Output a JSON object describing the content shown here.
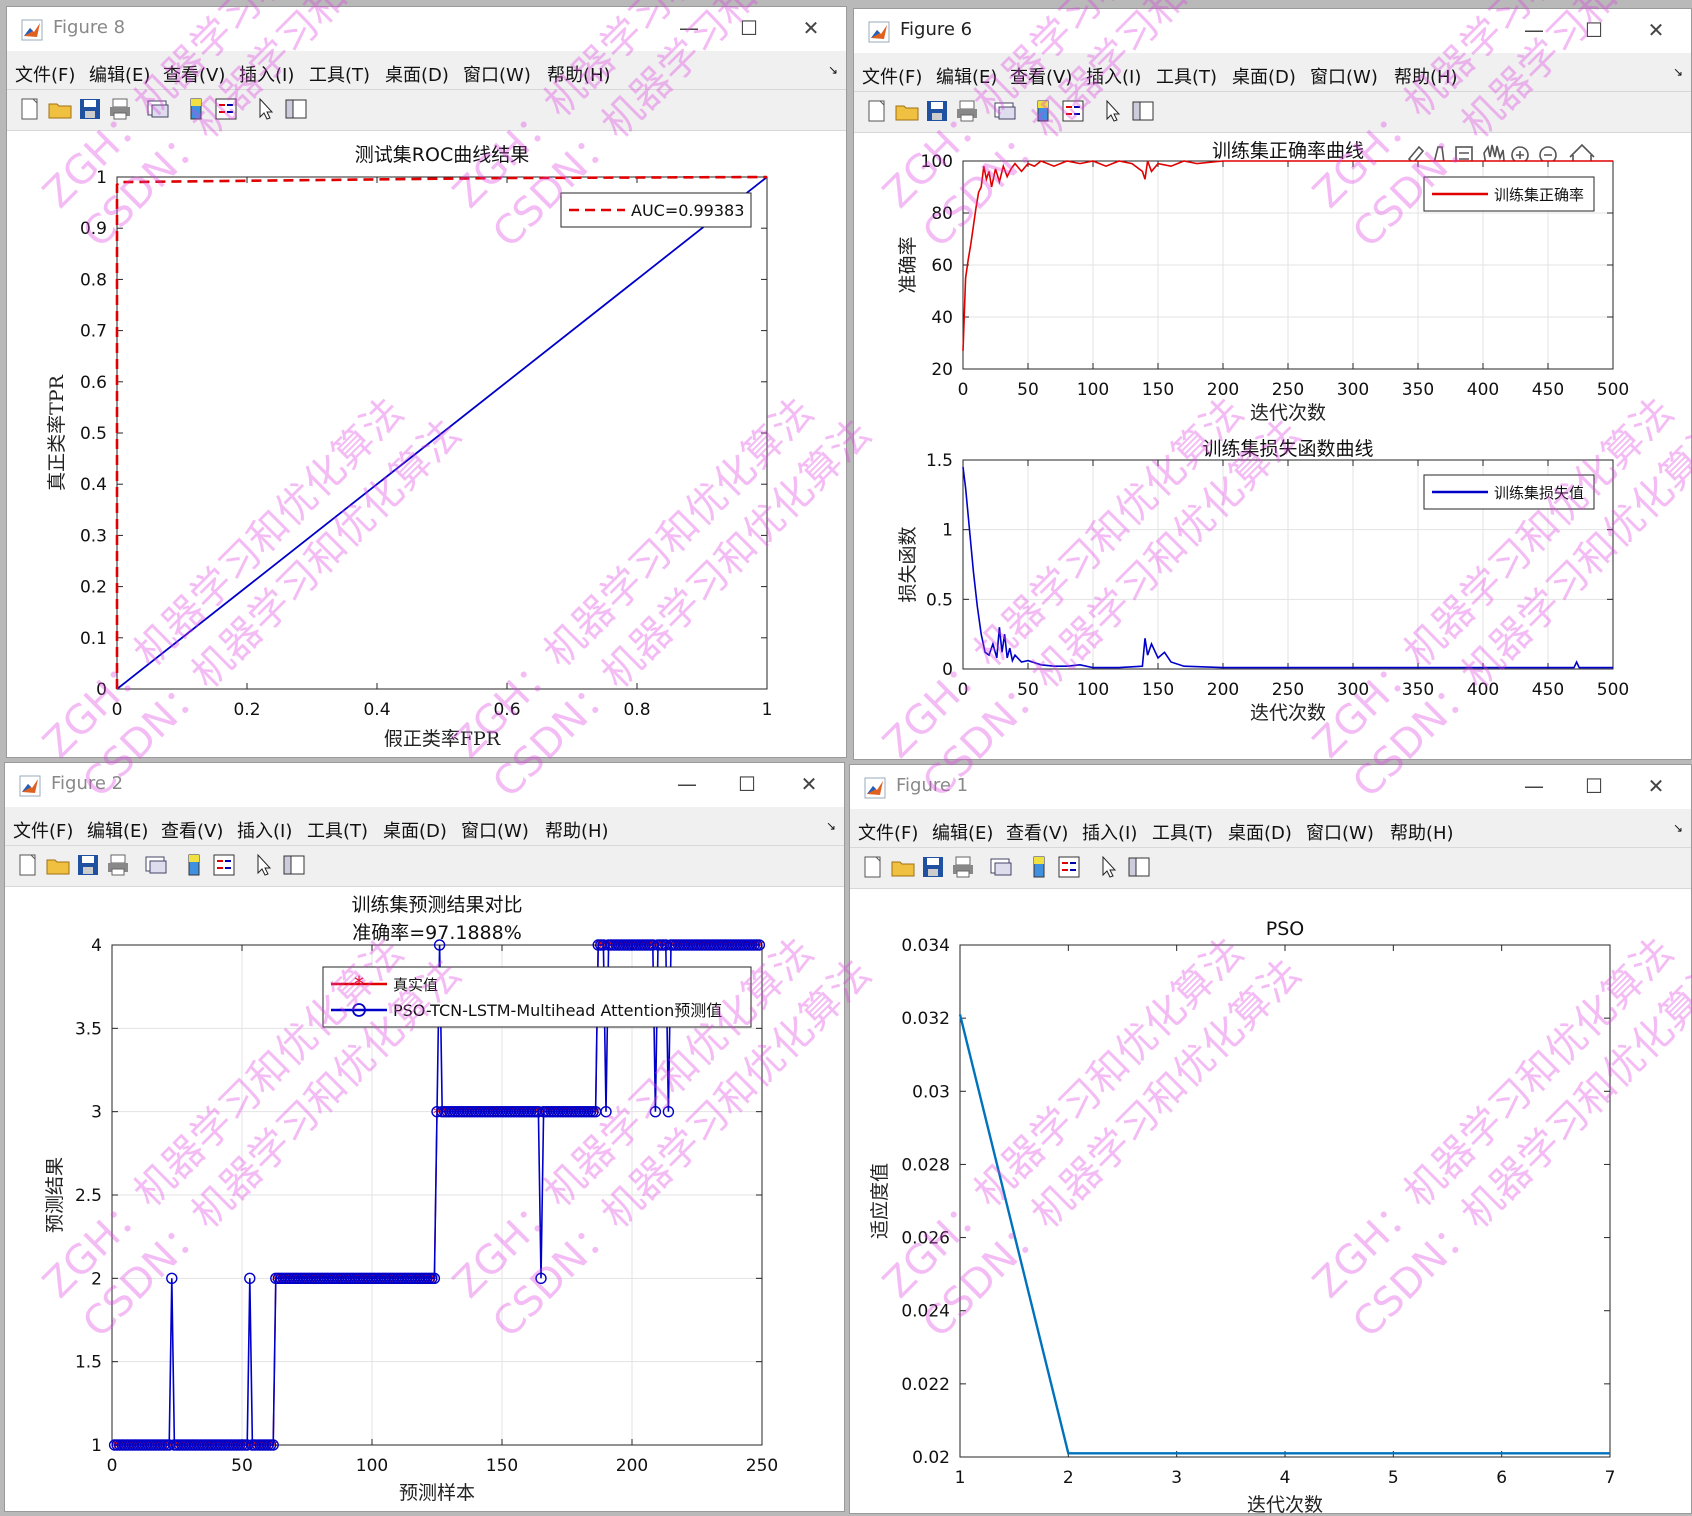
{
  "menu": [
    "文件(F)",
    "编辑(E)",
    "查看(V)",
    "插入(I)",
    "工具(T)",
    "桌面(D)",
    "窗口(W)",
    "帮助(H)"
  ],
  "windows": {
    "fig8": {
      "title": "Figure 8"
    },
    "fig6": {
      "title": "Figure 6"
    },
    "fig2": {
      "title": "Figure 2"
    },
    "fig1": {
      "title": "Figure 1"
    }
  },
  "watermark_lines": [
    "ZGH：机器学习和优化算法",
    "CSDN：机器学习和优化算法"
  ],
  "chart_data": [
    {
      "id": "roc",
      "type": "line",
      "title": "测试集ROC曲线结果",
      "xlabel": "假正类率FPR",
      "ylabel": "真正类率TPR",
      "xlim": [
        0,
        1
      ],
      "ylim": [
        0,
        1
      ],
      "xticks": [
        "0",
        "0.2",
        "0.4",
        "0.6",
        "0.8",
        "1"
      ],
      "yticks": [
        "0",
        "0.1",
        "0.2",
        "0.3",
        "0.4",
        "0.5",
        "0.6",
        "0.7",
        "0.8",
        "0.9",
        "1"
      ],
      "grid": false,
      "legend": "top-right",
      "series": [
        {
          "name": "AUC=0.99383",
          "color": "#e00000",
          "dash": true,
          "x": [
            0,
            0,
            0.003,
            0.3,
            0.6,
            1
          ],
          "y": [
            0,
            0.985,
            0.99,
            0.994,
            0.998,
            1
          ]
        },
        {
          "color": "#0000c8",
          "dash": false,
          "x": [
            0,
            1
          ],
          "y": [
            0,
            1
          ]
        }
      ]
    },
    {
      "id": "acc",
      "type": "line",
      "title": "训练集正确率曲线",
      "xlabel": "迭代次数",
      "ylabel": "准确率",
      "xlim": [
        0,
        500
      ],
      "ylim": [
        20,
        100
      ],
      "xticks": [
        "0",
        "50",
        "100",
        "150",
        "200",
        "250",
        "300",
        "350",
        "400",
        "450",
        "500"
      ],
      "yticks": [
        "20",
        "40",
        "60",
        "80",
        "100"
      ],
      "grid": true,
      "legend": "top-right",
      "series": [
        {
          "name": "训练集正确率",
          "color": "#e00000",
          "x": [
            0,
            2,
            4,
            6,
            8,
            10,
            12,
            14,
            16,
            18,
            20,
            22,
            25,
            28,
            31,
            34,
            37,
            40,
            45,
            50,
            55,
            60,
            70,
            80,
            90,
            100,
            110,
            120,
            130,
            138,
            140,
            142,
            145,
            150,
            160,
            170,
            180,
            200,
            250,
            300,
            350,
            400,
            450,
            500
          ],
          "y": [
            27,
            55,
            62,
            68,
            75,
            82,
            88,
            90,
            98,
            93,
            96,
            90,
            97,
            92,
            98,
            94,
            97,
            99,
            96,
            99,
            98,
            100,
            98,
            100,
            99,
            100,
            98,
            100,
            99,
            96,
            93,
            100,
            96,
            99,
            98,
            100,
            99,
            100,
            100,
            100,
            100,
            100,
            100,
            100
          ]
        }
      ]
    },
    {
      "id": "loss",
      "type": "line",
      "title": "训练集损失函数曲线",
      "xlabel": "迭代次数",
      "ylabel": "损失函数",
      "xlim": [
        0,
        500
      ],
      "ylim": [
        0,
        1.5
      ],
      "xticks": [
        "0",
        "50",
        "100",
        "150",
        "200",
        "250",
        "300",
        "350",
        "400",
        "450",
        "500"
      ],
      "yticks": [
        "0",
        "0.5",
        "1",
        "1.5"
      ],
      "grid": true,
      "legend": "top-right",
      "series": [
        {
          "name": "训练集损失值",
          "color": "#0000c8",
          "x": [
            0,
            2,
            5,
            8,
            11,
            14,
            17,
            20,
            23,
            26,
            28,
            30,
            32,
            34,
            36,
            38,
            40,
            45,
            50,
            60,
            70,
            80,
            90,
            100,
            120,
            138,
            140,
            142,
            145,
            150,
            155,
            160,
            170,
            200,
            250,
            300,
            350,
            400,
            470,
            472,
            474,
            500
          ],
          "y": [
            1.45,
            1.3,
            1.0,
            0.7,
            0.45,
            0.25,
            0.12,
            0.1,
            0.18,
            0.08,
            0.3,
            0.12,
            0.25,
            0.08,
            0.15,
            0.06,
            0.1,
            0.05,
            0.06,
            0.03,
            0.02,
            0.02,
            0.03,
            0.01,
            0.01,
            0.02,
            0.22,
            0.1,
            0.18,
            0.08,
            0.12,
            0.05,
            0.02,
            0.01,
            0.01,
            0.01,
            0.01,
            0.01,
            0.01,
            0.05,
            0.01,
            0.01
          ]
        }
      ]
    },
    {
      "id": "pred",
      "type": "line",
      "title": "训练集预测结果对比",
      "subtitle": "准确率=97.1888%",
      "xlabel": "预测样本",
      "ylabel": "预测结果",
      "xlim": [
        0,
        250
      ],
      "ylim": [
        1,
        4
      ],
      "xticks": [
        "0",
        "50",
        "100",
        "150",
        "200",
        "250"
      ],
      "yticks": [
        "1",
        "1.5",
        "2",
        "2.5",
        "3",
        "3.5",
        "4"
      ],
      "grid": true,
      "legend": "top-right",
      "segments_true": [
        {
          "from": 1,
          "to": 63,
          "class": 1
        },
        {
          "from": 63,
          "to": 125,
          "class": 2
        },
        {
          "from": 125,
          "to": 187,
          "class": 3
        },
        {
          "from": 187,
          "to": 249,
          "class": 4
        }
      ],
      "mismatches": [
        {
          "x": 23,
          "pred": 2
        },
        {
          "x": 53,
          "pred": 2
        },
        {
          "x": 126,
          "pred": 4
        },
        {
          "x": 165,
          "pred": 2
        },
        {
          "x": 190,
          "pred": 3
        },
        {
          "x": 209,
          "pred": 3
        },
        {
          "x": 214,
          "pred": 3
        }
      ],
      "series": [
        {
          "name": "真实值",
          "color": "#e00000",
          "marker": "*"
        },
        {
          "name": "PSO-TCN-LSTM-Multihead Attention预测值",
          "color": "#0000c8",
          "marker": "o"
        }
      ]
    },
    {
      "id": "pso",
      "type": "line",
      "title": "PSO",
      "xlabel": "迭代次数",
      "ylabel": "适应度值",
      "xlim": [
        1,
        7
      ],
      "ylim": [
        0.02,
        0.034
      ],
      "xticks": [
        "1",
        "2",
        "3",
        "4",
        "5",
        "6",
        "7"
      ],
      "yticks": [
        "0.02",
        "0.022",
        "0.024",
        "0.026",
        "0.028",
        "0.03",
        "0.032",
        "0.034"
      ],
      "grid": false,
      "series": [
        {
          "color": "#0072bd",
          "x": [
            1,
            2,
            3,
            4,
            5,
            6,
            7
          ],
          "y": [
            0.0321,
            0.0201,
            0.0201,
            0.0201,
            0.0201,
            0.0201,
            0.0201
          ]
        }
      ]
    }
  ]
}
